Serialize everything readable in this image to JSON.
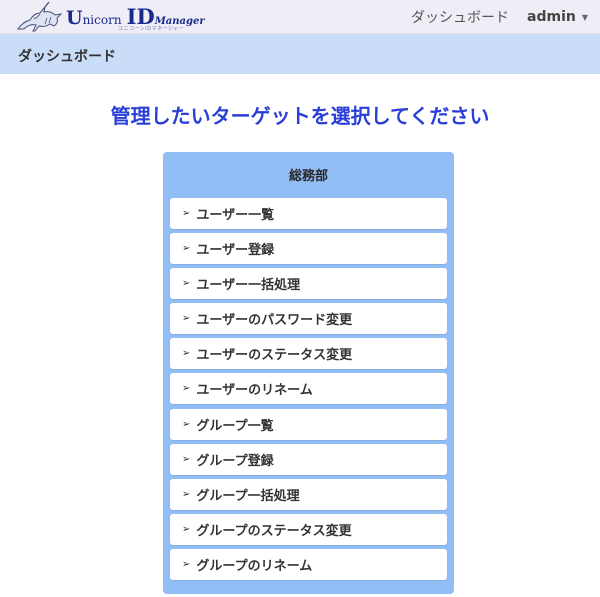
{
  "header": {
    "logo": {
      "text_u": "U",
      "text_nicorn": "nicorn",
      "text_id": "ID",
      "text_manager": "Manager",
      "subtitle": "ユニコーンIDマネージャー",
      "icon": "unicorn-logo-icon"
    },
    "nav": {
      "dashboard_link": "ダッシュボード",
      "user_menu": "admin",
      "user_menu_icon": "caret-down-icon"
    }
  },
  "breadcrumb": {
    "current": "ダッシュボード"
  },
  "main": {
    "title": "管理したいターゲットを選択してください",
    "panel": {
      "title": "総務部",
      "item_icon": "arrow-right-icon",
      "arrow_glyph": "➢",
      "items": [
        "ユーザー一覧",
        "ユーザー登録",
        "ユーザー一括処理",
        "ユーザーのパスワード変更",
        "ユーザーのステータス変更",
        "ユーザーのリネーム",
        "グループ一覧",
        "グループ登録",
        "グループ一括処理",
        "グループのステータス変更",
        "グループのリネーム"
      ]
    }
  },
  "colors": {
    "nav_bg": "#efeef6",
    "breadcrumb_bg": "#c9dcf8",
    "title_color": "#2a3ed8",
    "panel_bg": "#93bdf5",
    "item_bg": "#ffffff",
    "logo_color": "#1a2a8c"
  }
}
